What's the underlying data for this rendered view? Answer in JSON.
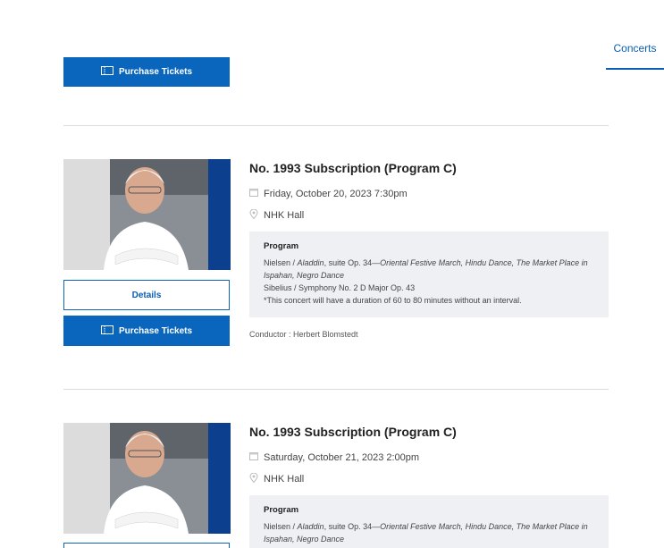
{
  "nav": {
    "tab_label": "Concerts"
  },
  "buttons": {
    "purchase_label": "Purchase Tickets",
    "details_label": "Details"
  },
  "concerts": [
    {
      "title": "No. 1993 Subscription (Program C)",
      "date": "Friday, October 20, 2023 7:30pm",
      "venue": "NHK Hall",
      "program_heading": "Program",
      "work1_prefix": "Nielsen / ",
      "work1_title": "Aladdin",
      "work1_mid": ", suite Op. 34—",
      "work1_movements": "Oriental Festive March, Hindu Dance, The Market Place in Ispahan, Negro Dance",
      "work2": "Sibelius / Symphony No. 2 D Major Op. 43",
      "note": "*This concert will have a duration of 60 to 80 minutes without an interval.",
      "conductor": "Conductor : Herbert Blomstedt"
    },
    {
      "title": "No. 1993 Subscription (Program C)",
      "date": "Saturday, October 21, 2023 2:00pm",
      "venue": "NHK Hall",
      "program_heading": "Program",
      "work1_prefix": "Nielsen / ",
      "work1_title": "Aladdin",
      "work1_mid": ", suite Op. 34—",
      "work1_movements": "Oriental Festive March, Hindu Dance, The Market Place in Ispahan, Negro Dance"
    }
  ],
  "colors": {
    "accent": "#0a66bd",
    "program_bg": "#eef0f4",
    "divider": "#dcdcdc"
  }
}
